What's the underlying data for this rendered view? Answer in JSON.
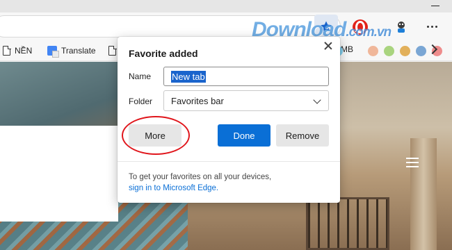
{
  "favorites_bar": {
    "items": [
      {
        "label": "NỀN",
        "icon": "page-icon"
      },
      {
        "label": "Translate",
        "icon": "google-translate-icon"
      },
      {
        "label": "",
        "icon": "page-icon"
      }
    ],
    "peek_label": "MB",
    "color_dots": [
      "#7ecbea",
      "#f0b79a",
      "#a9d47f",
      "#e2b05b",
      "#7aa6d4",
      "#ee8c8c"
    ]
  },
  "watermark": {
    "text": "Download",
    "suffix": ".com.vn"
  },
  "popup": {
    "title": "Favorite added",
    "name_label": "Name",
    "name_value": "New tab",
    "folder_label": "Folder",
    "folder_value": "Favorites bar",
    "more_label": "More",
    "done_label": "Done",
    "remove_label": "Remove",
    "hint_text": "To get your favorites on all your devices,",
    "hint_link": "sign in to Microsoft Edge."
  },
  "colors": {
    "accent": "#0a6fd6",
    "selection": "#1a64cc",
    "annotation": "#e0151b"
  }
}
